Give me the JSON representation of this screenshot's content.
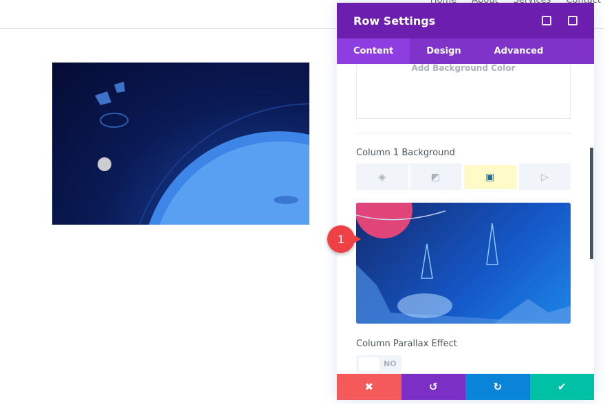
{
  "nav": [
    "Home",
    "About",
    "Services",
    "Contact"
  ],
  "panel": {
    "title": "Row Settings",
    "tabs": [
      "Content",
      "Design",
      "Advanced"
    ],
    "active_tab": "Content",
    "add_bg_color": "Add Background Color",
    "column_bg_label": "Column 1 Background",
    "bg_tabs": [
      {
        "icon": "paint-bucket-icon"
      },
      {
        "icon": "gradient-icon"
      },
      {
        "icon": "image-icon",
        "active": true
      },
      {
        "icon": "video-icon"
      }
    ],
    "parallax_label": "Column Parallax Effect",
    "parallax_value": "NO",
    "footer": {
      "cancel": "✖",
      "undo": "↺",
      "redo": "↻",
      "save": "✔"
    }
  },
  "badge": "1",
  "colors": {
    "header": "#6c1fae",
    "tabs": "#8033c9",
    "cancel": "#f55a5a",
    "undo": "#7b2fc4",
    "redo": "#0a84d8",
    "save": "#00c1a6"
  }
}
